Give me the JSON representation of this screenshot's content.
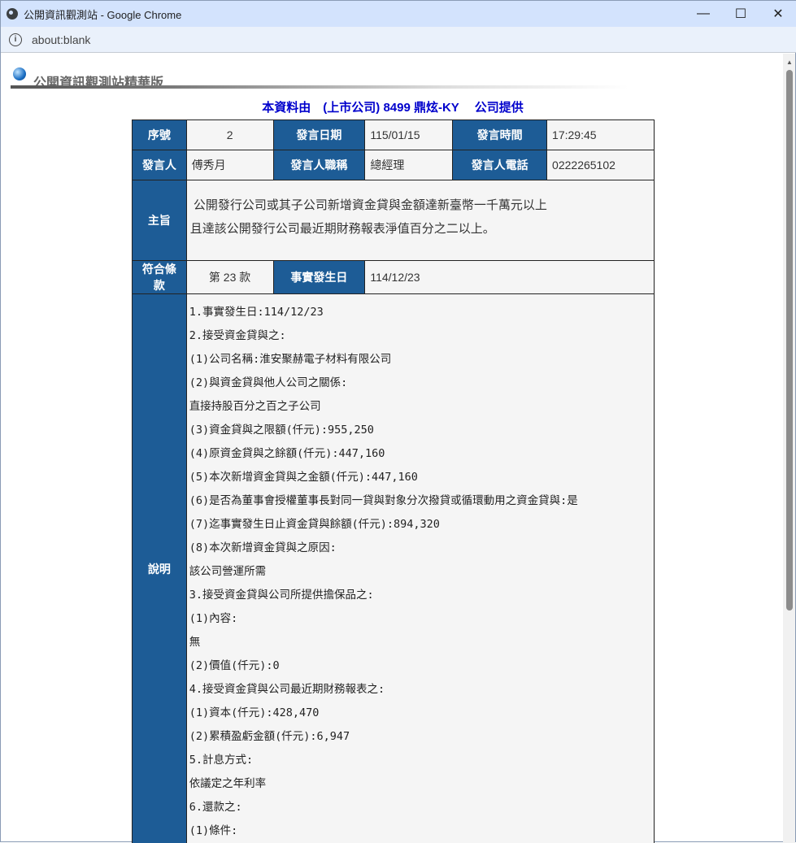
{
  "window": {
    "title": "公開資訊觀測站 - Google Chrome",
    "url": "about:blank",
    "minimize": "—",
    "maximize": "☐",
    "close": "✕"
  },
  "page": {
    "site_name": "公開資訊觀測站精華版",
    "provider": "本資料由　(上市公司) 8499 鼎炫-KY　 公司提供"
  },
  "table": {
    "seq_label": "序號",
    "seq": "2",
    "date_label": "發言日期",
    "date": "115/01/15",
    "time_label": "發言時間",
    "time": "17:29:45",
    "speaker_label": "發言人",
    "speaker": "傅秀月",
    "title_label": "發言人職稱",
    "title": "總經理",
    "phone_label": "發言人電話",
    "phone": "0222265102",
    "subject_label": "主旨",
    "subject_line1": " 公開發行公司或其子公司新增資金貸與金額達新臺幣一千萬元以上",
    "subject_line2": "且達該公開發行公司最近期財務報表淨值百分之二以上。",
    "clause_label": "符合條款",
    "clause": "第 23 款",
    "event_date_label": "事實發生日",
    "event_date": "114/12/23",
    "desc_label": "說明",
    "desc_lines": [
      "1.事實發生日:114/12/23",
      "2.接受資金貸與之:",
      "(1)公司名稱:淮安聚赫電子材料有限公司",
      "(2)與資金貸與他人公司之關係:",
      "直接持股百分之百之子公司",
      "(3)資金貸與之限額(仟元):955,250",
      "(4)原資金貸與之餘額(仟元):447,160",
      "(5)本次新增資金貸與之金額(仟元):447,160",
      "(6)是否為董事會授權董事長對同一貸與對象分次撥貸或循環動用之資金貸與:是",
      "(7)迄事實發生日止資金貸與餘額(仟元):894,320",
      "(8)本次新增資金貸與之原因:",
      "該公司營運所需",
      "3.接受資金貸與公司所提供擔保品之:",
      "(1)內容:",
      "無",
      "(2)價值(仟元):0",
      "4.接受資金貸與公司最近期財務報表之:",
      "(1)資本(仟元):428,470",
      "(2)累積盈虧金額(仟元):6,947",
      "5.計息方式:",
      "依議定之年利率",
      "6.還款之:",
      "(1)條件:"
    ]
  }
}
